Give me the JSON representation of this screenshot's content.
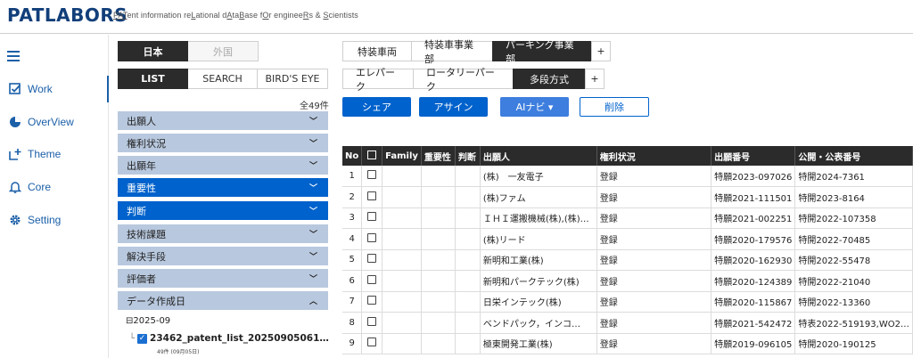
{
  "header": {
    "logo": "PATLABORS",
    "tagline_parts": [
      {
        "t": "PAT",
        "u": true
      },
      {
        "t": "ent information re",
        "u": false
      },
      {
        "t": "L",
        "u": true
      },
      {
        "t": "ational d",
        "u": false
      },
      {
        "t": "A",
        "u": true
      },
      {
        "t": "ta",
        "u": false
      },
      {
        "t": "B",
        "u": true
      },
      {
        "t": "ase f",
        "u": false
      },
      {
        "t": "O",
        "u": true
      },
      {
        "t": "r enginee",
        "u": false
      },
      {
        "t": "R",
        "u": true
      },
      {
        "t": "s & ",
        "u": false
      },
      {
        "t": "S",
        "u": true
      },
      {
        "t": "cientists",
        "u": false
      }
    ]
  },
  "nav": {
    "items": [
      {
        "label": "Work",
        "icon": "check-square-icon"
      },
      {
        "label": "OverView",
        "icon": "pie-chart-icon"
      },
      {
        "label": "Theme",
        "icon": "add-box-icon"
      },
      {
        "label": "Core",
        "icon": "bell-icon"
      },
      {
        "label": "Setting",
        "icon": "gear-icon"
      }
    ]
  },
  "region_toggle": [
    "日本",
    "外国"
  ],
  "view_toggle": [
    "LIST",
    "SEARCH",
    "BIRD'S EYE"
  ],
  "result_count": "全49件",
  "facets": [
    "出願人",
    "権利状況",
    "出願年",
    "重要性",
    "判断",
    "技術課題",
    "解決手段",
    "評価者",
    "データ作成日"
  ],
  "tree": {
    "month": "2025-09",
    "file": "23462_patent_list_20250905061…",
    "sub": "49件  (09月05日)"
  },
  "tabs_top": [
    "特装車両",
    "特装車事業部",
    "パーキング事業部",
    "+"
  ],
  "tabs_sub": [
    "エレパーク",
    "ロータリーパーク",
    "多段方式",
    "+"
  ],
  "actions": {
    "share": "シェア",
    "assign": "アサイン",
    "ai": "AIナビ ▾",
    "delete": "削除"
  },
  "table": {
    "headers": [
      "No",
      "",
      "Family",
      "重要性",
      "判断",
      "出願人",
      "権利状況",
      "出願番号",
      "公開・公表番号"
    ],
    "rows": [
      [
        "1",
        "",
        "",
        "",
        "",
        "(株)　一友電子",
        "登録",
        "特願2023-097026",
        "特開2024-7361"
      ],
      [
        "2",
        "",
        "",
        "",
        "",
        "(株)ファム",
        "登録",
        "特願2021-111501",
        "特開2023-8164"
      ],
      [
        "3",
        "",
        "",
        "",
        "",
        "ＩＨＩ運搬機械(株),(株)…",
        "登録",
        "特願2021-002251",
        "特開2022-107358"
      ],
      [
        "4",
        "",
        "",
        "",
        "",
        "(株)リード",
        "登録",
        "特願2020-179576",
        "特開2022-70485"
      ],
      [
        "5",
        "",
        "",
        "",
        "",
        "新明和工業(株)",
        "登録",
        "特願2020-162930",
        "特開2022-55478"
      ],
      [
        "6",
        "",
        "",
        "",
        "",
        "新明和パークテック(株)",
        "登録",
        "特願2020-124389",
        "特開2022-21040"
      ],
      [
        "7",
        "",
        "",
        "",
        "",
        "日栄インテック(株)",
        "登録",
        "特願2020-115867",
        "特開2022-13360"
      ],
      [
        "8",
        "",
        "",
        "",
        "",
        "ベンドパック，インコ…",
        "登録",
        "特願2021-542472",
        "特表2022-519193,WO2…"
      ],
      [
        "9",
        "",
        "",
        "",
        "",
        "極東開発工業(株)",
        "登録",
        "特願2019-096105",
        "特開2020-190125"
      ]
    ]
  }
}
